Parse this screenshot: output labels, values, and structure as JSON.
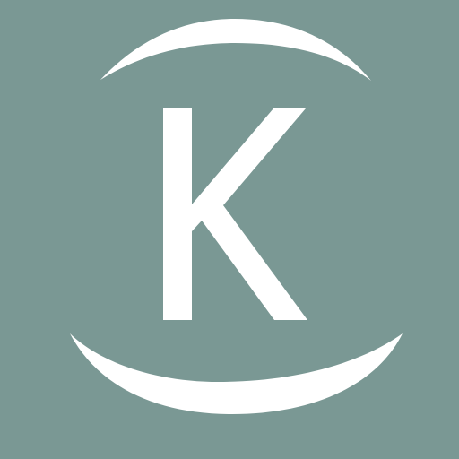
{
  "logo": {
    "letter": "K",
    "background_color": "#7A9894",
    "foreground_color": "#FFFFFF"
  }
}
